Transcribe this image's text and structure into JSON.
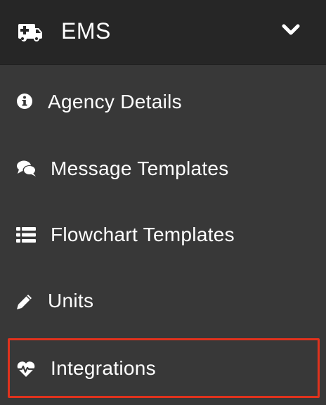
{
  "header": {
    "title": "EMS",
    "icon": "ambulance-icon",
    "toggle_icon": "chevron-down-icon"
  },
  "items": [
    {
      "label": "Agency Details",
      "icon": "info-circle-icon"
    },
    {
      "label": "Message Templates",
      "icon": "comments-icon"
    },
    {
      "label": "Flowchart Templates",
      "icon": "list-icon"
    },
    {
      "label": "Units",
      "icon": "pencil-icon"
    },
    {
      "label": "Integrations",
      "icon": "heartbeat-icon",
      "highlighted": true
    }
  ],
  "colors": {
    "background": "#383838",
    "header_background": "#262626",
    "text": "#ffffff",
    "highlight_border": "#e0321d"
  }
}
